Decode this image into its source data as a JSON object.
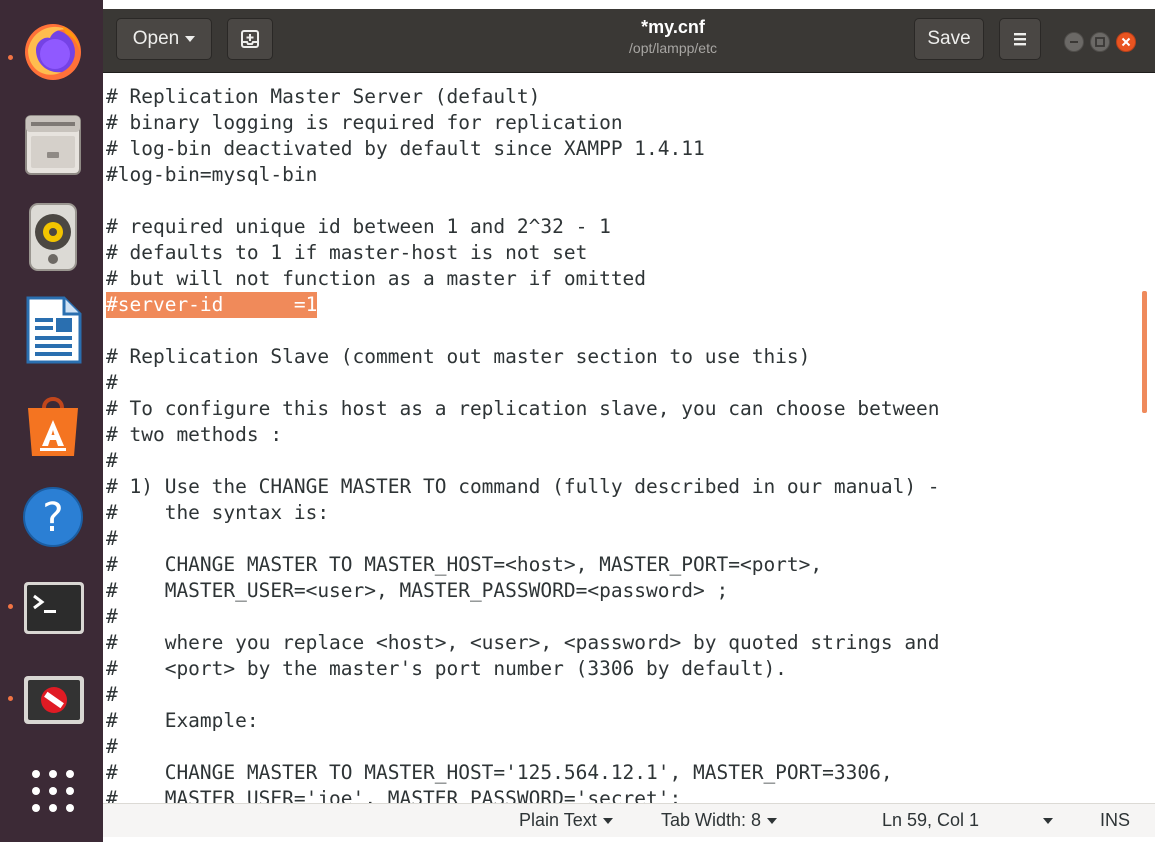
{
  "window": {
    "title": "*my.cnf",
    "path": "/opt/lampp/etc",
    "open_label": "Open",
    "save_label": "Save"
  },
  "dock": {
    "items": [
      {
        "name": "firefox-icon",
        "running": true
      },
      {
        "name": "files-icon",
        "running": false
      },
      {
        "name": "rhythmbox-icon",
        "running": false
      },
      {
        "name": "libreoffice-writer-icon",
        "running": false
      },
      {
        "name": "ubuntu-software-icon",
        "running": false
      },
      {
        "name": "help-icon",
        "running": false
      },
      {
        "name": "terminal-icon",
        "running": true
      },
      {
        "name": "unknown-app-icon",
        "running": true
      },
      {
        "name": "show-applications-icon",
        "running": false
      }
    ]
  },
  "editor": {
    "lines": [
      "# Replication Master Server (default)",
      "# binary logging is required for replication",
      "# log-bin deactivated by default since XAMPP 1.4.11",
      "#log-bin=mysql-bin",
      "",
      "# required unique id between 1 and 2^32 - 1",
      "# defaults to 1 if master-host is not set",
      "# but will not function as a master if omitted",
      "#server-id\t=1",
      "",
      "# Replication Slave (comment out master section to use this)",
      "#",
      "# To configure this host as a replication slave, you can choose between",
      "# two methods :",
      "#",
      "# 1) Use the CHANGE MASTER TO command (fully described in our manual) -",
      "#    the syntax is:",
      "#",
      "#    CHANGE MASTER TO MASTER_HOST=<host>, MASTER_PORT=<port>,",
      "#    MASTER_USER=<user>, MASTER_PASSWORD=<password> ;",
      "#",
      "#    where you replace <host>, <user>, <password> by quoted strings and",
      "#    <port> by the master's port number (3306 by default).",
      "#",
      "#    Example:",
      "#",
      "#    CHANGE MASTER TO MASTER_HOST='125.564.12.1', MASTER_PORT=3306,",
      "#    MASTER_USER='joe', MASTER_PASSWORD='secret';"
    ],
    "selected_line": 8
  },
  "statusbar": {
    "language": "Plain Text",
    "tab_width": "Tab Width: 8",
    "position": "Ln 59, Col 1",
    "mode": "INS"
  },
  "colors": {
    "accent": "#E95420",
    "selection": "#F08A5A",
    "dock_bg": "#3C2A36",
    "headerbar_bg": "#3A3835"
  }
}
